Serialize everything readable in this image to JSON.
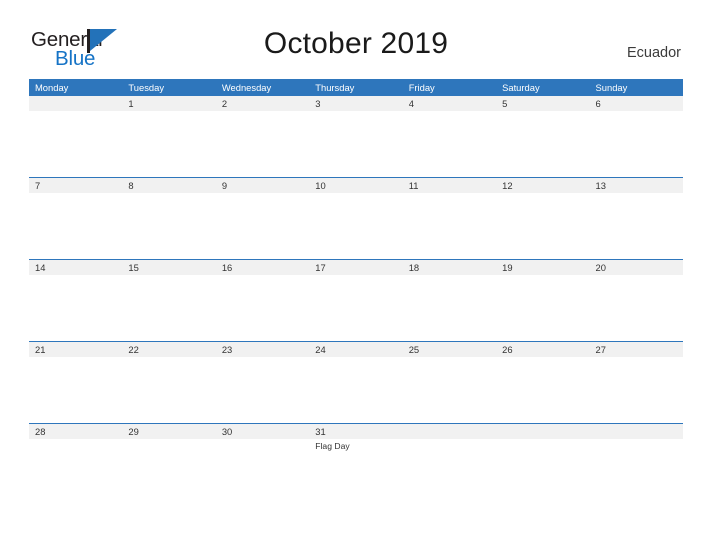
{
  "brand": {
    "name_part1": "General",
    "name_part2": "Blue",
    "flag_icon": "flag-icon",
    "accent_color": "#2e76bc",
    "text_color": "#231f20"
  },
  "header": {
    "title": "October 2019",
    "country": "Ecuador"
  },
  "calendar": {
    "month": "October",
    "year": "2019",
    "week_start": "Monday",
    "header_background": "#2e76bc",
    "daystrip_background": "#f1f1f1",
    "weekdays": [
      "Monday",
      "Tuesday",
      "Wednesday",
      "Thursday",
      "Friday",
      "Saturday",
      "Sunday"
    ],
    "weeks": [
      {
        "days": [
          {
            "number": "",
            "events": []
          },
          {
            "number": "1",
            "events": []
          },
          {
            "number": "2",
            "events": []
          },
          {
            "number": "3",
            "events": []
          },
          {
            "number": "4",
            "events": []
          },
          {
            "number": "5",
            "events": []
          },
          {
            "number": "6",
            "events": []
          }
        ]
      },
      {
        "days": [
          {
            "number": "7",
            "events": []
          },
          {
            "number": "8",
            "events": []
          },
          {
            "number": "9",
            "events": []
          },
          {
            "number": "10",
            "events": []
          },
          {
            "number": "11",
            "events": []
          },
          {
            "number": "12",
            "events": []
          },
          {
            "number": "13",
            "events": []
          }
        ]
      },
      {
        "days": [
          {
            "number": "14",
            "events": []
          },
          {
            "number": "15",
            "events": []
          },
          {
            "number": "16",
            "events": []
          },
          {
            "number": "17",
            "events": []
          },
          {
            "number": "18",
            "events": []
          },
          {
            "number": "19",
            "events": []
          },
          {
            "number": "20",
            "events": []
          }
        ]
      },
      {
        "days": [
          {
            "number": "21",
            "events": []
          },
          {
            "number": "22",
            "events": []
          },
          {
            "number": "23",
            "events": []
          },
          {
            "number": "24",
            "events": []
          },
          {
            "number": "25",
            "events": []
          },
          {
            "number": "26",
            "events": []
          },
          {
            "number": "27",
            "events": []
          }
        ]
      },
      {
        "days": [
          {
            "number": "28",
            "events": []
          },
          {
            "number": "29",
            "events": []
          },
          {
            "number": "30",
            "events": []
          },
          {
            "number": "31",
            "events": [
              "Flag Day"
            ]
          },
          {
            "number": "",
            "events": []
          },
          {
            "number": "",
            "events": []
          },
          {
            "number": "",
            "events": []
          }
        ]
      }
    ]
  }
}
